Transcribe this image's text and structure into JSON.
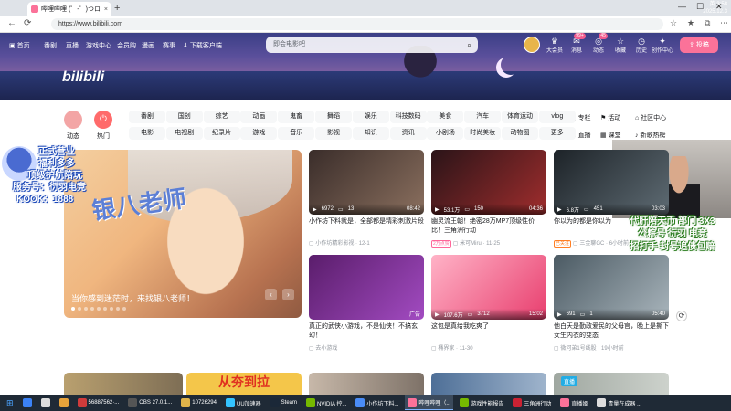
{
  "browser": {
    "tab_title": "哔哩哔哩 (゜-゜)つロ 干杯~-bilibili",
    "tab_close": "×",
    "new_tab": "+",
    "url": "https://www.bilibili.com",
    "win_min": "—",
    "win_max": "☐",
    "win_close": "✕",
    "back": "←",
    "refresh": "⟳"
  },
  "header": {
    "logo": "bilibili",
    "nav": [
      "首页",
      "番剧",
      "直播",
      "游戏中心",
      "会员购",
      "漫画",
      "赛事",
      "下载客户端"
    ],
    "search_placeholder": "即会电影吧",
    "icons": [
      {
        "label": "大会员",
        "badge": "",
        "icon": "crown-icon"
      },
      {
        "label": "消息",
        "badge": "99+",
        "icon": "message-icon"
      },
      {
        "label": "动态",
        "badge": "45",
        "icon": "feed-icon"
      },
      {
        "label": "收藏",
        "badge": "",
        "icon": "star-icon"
      },
      {
        "label": "历史",
        "badge": "",
        "icon": "clock-icon"
      },
      {
        "label": "创作中心",
        "badge": "",
        "icon": "lightbulb-icon"
      }
    ],
    "upload": "投稿",
    "accent": "#fb7299"
  },
  "channels": {
    "quick": [
      {
        "label": "动态",
        "color": "#f3a5a5"
      },
      {
        "label": "热门",
        "color": "#ff6b6b"
      }
    ],
    "row1": [
      "番剧",
      "国创",
      "综艺",
      "动画",
      "鬼畜",
      "舞蹈",
      "娱乐",
      "科技数码",
      "美食",
      "汽车",
      "体育运动",
      "vlog"
    ],
    "row2": [
      "电影",
      "电视剧",
      "纪录片",
      "游戏",
      "音乐",
      "影视",
      "知识",
      "资讯",
      "小剧场",
      "时尚美妆",
      "动物圈",
      "更多"
    ],
    "side": [
      "专栏",
      "活动",
      "社区中心",
      "直播",
      "课堂",
      "新歌热榜"
    ]
  },
  "carousel": {
    "caption": "当你感到迷茫时，来找银八老师！",
    "art_title": "银八老师",
    "dots": 9
  },
  "videos": [
    {
      "title": "小作坊下料就是，全部都是精彩刺激片段",
      "views": "6972",
      "danmaku": "13",
      "duration": "08:42",
      "uploader": "小作坊精彩影视",
      "date": "12-1",
      "tag": "",
      "ad": ""
    },
    {
      "title": "幽灵流王朝！绝密28万MP7顶级性价比！三角洲行动",
      "views": "53.1万",
      "danmaku": "150",
      "duration": "04:36",
      "uploader": "米可Miru",
      "date": "11-25",
      "tag": "2万点赞",
      "ad": ""
    },
    {
      "title": "你以为的都是你以为",
      "views": "6.8万",
      "danmaku": "451",
      "duration": "03:03",
      "uploader": "三金聊GC",
      "date": "6小时前",
      "tag": "已关注",
      "ad": ""
    },
    {
      "title": "真正的武侠小游戏，不是仙侠！不搞玄幻！",
      "views": "",
      "danmaku": "",
      "duration": "",
      "uploader": "去小游戏",
      "date": "",
      "tag": "",
      "ad": "广告"
    },
    {
      "title": "这包是真给我吃爽了",
      "views": "107.6万",
      "danmaku": "3712",
      "duration": "15:02",
      "uploader": "桶界家",
      "date": "11-30",
      "tag": "",
      "ad": ""
    },
    {
      "title": "他白天是勤政爱民的父母官，晚上是撕下女生内衣的变态",
      "views": "691",
      "danmaku": "1",
      "duration": "05:40",
      "uploader": "微河弟1号线股",
      "date": "19小时前",
      "tag": "",
      "ad": ""
    }
  ],
  "overlay_left": [
    "正式营业",
    "福利多多",
    "顶级护航陪玩",
    "服务号：衍羽电竞",
    "KOOK：1888"
  ],
  "overlay_right": [
    "代肝陪天币 部门 3X3",
    "公粽号 衍羽 电竞",
    "招打手 封号追债包赔"
  ],
  "bottom_row": {
    "partial_title": "从夯到拉",
    "live_badge": "直播"
  },
  "taskbar": {
    "items": [
      {
        "label": "",
        "color": "#3b82f6"
      },
      {
        "label": "",
        "color": "#ddd"
      },
      {
        "label": "",
        "color": "#e8a33a"
      },
      {
        "label": "56887562·...",
        "color": "#cf3b3b"
      },
      {
        "label": "OBS 27.0.1...",
        "color": "#555"
      },
      {
        "label": "10726294",
        "color": "#e0b44a"
      },
      {
        "label": "UU加速器",
        "color": "#34c3ff"
      },
      {
        "label": "Steam",
        "color": "#1b2838"
      },
      {
        "label": "NVIDIA 控...",
        "color": "#76b900"
      },
      {
        "label": "小作坊下料...",
        "color": "#4a8cf7"
      },
      {
        "label": "哔哩哔哩（...",
        "color": "#fb7299"
      },
      {
        "label": "游戏性能报告",
        "color": "#76b900"
      },
      {
        "label": "三角洲行动",
        "color": "#c23"
      },
      {
        "label": "直播姬",
        "color": "#fb7299"
      },
      {
        "label": "青量在成器 ...",
        "color": "#ddd"
      }
    ],
    "tray_lang": "英",
    "time": "3:58",
    "date": "2025.12.3"
  }
}
